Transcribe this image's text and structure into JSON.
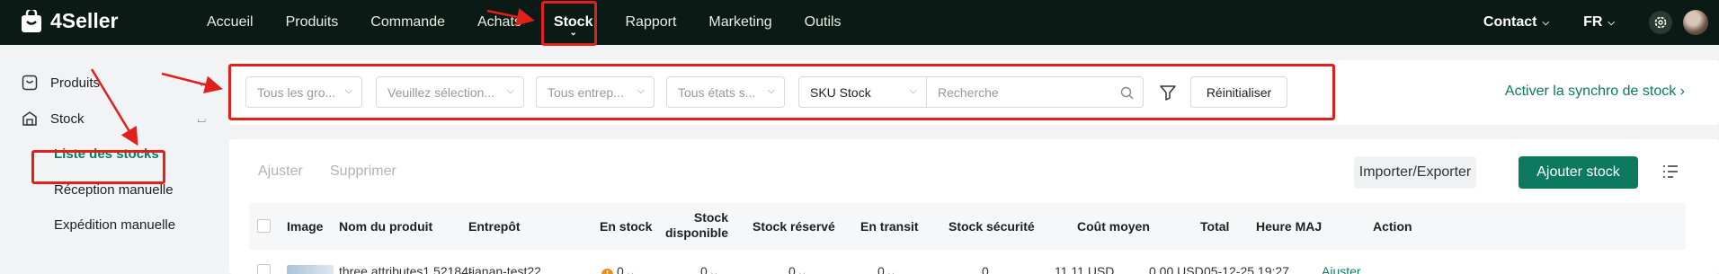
{
  "app": {
    "name": "4Seller"
  },
  "topnav": {
    "items": [
      "Accueil",
      "Produits",
      "Commande",
      "Achats",
      "Stock",
      "Rapport",
      "Marketing",
      "Outils"
    ],
    "active": "Stock"
  },
  "header_right": {
    "contact": "Contact",
    "language": "FR"
  },
  "sidebar": {
    "groups": [
      {
        "label": "Produits",
        "expanded": false
      },
      {
        "label": "Stock",
        "expanded": true
      }
    ],
    "stock_items": [
      "Liste des stocks",
      "Réception manuelle",
      "Expédition manuelle"
    ],
    "active_item": "Liste des stocks"
  },
  "filters": {
    "groups_placeholder": "Tous les gro...",
    "select_placeholder": "Veuillez sélection...",
    "warehouse_placeholder": "Tous entrep...",
    "status_placeholder": "Tous états s...",
    "search_type": "SKU Stock",
    "search_placeholder": "Recherche",
    "reset_label": "Réinitialiser",
    "sync_link": "Activer la synchro de stock"
  },
  "toolbar": {
    "adjust_label": "Ajuster",
    "delete_label": "Supprimer",
    "import_export_label": "Importer/Exporter",
    "add_stock_label": "Ajouter stock"
  },
  "table": {
    "headers": {
      "image": "Image",
      "product_name": "Nom du produit",
      "warehouse": "Entrepôt",
      "in_stock": "En stock",
      "available_line1": "Stock",
      "available_line2": "disponible",
      "reserved": "Stock réservé",
      "in_transit": "En transit",
      "safety": "Stock sécurité",
      "avg_cost": "Coût moyen",
      "total": "Total",
      "updated": "Heure MAJ",
      "action": "Action"
    },
    "rows": [
      {
        "product_name": "three attributes1 52184-",
        "warehouse": "tianan-test22",
        "in_stock": "0",
        "available": "0",
        "reserved": "0",
        "in_transit": "0",
        "safety": "0",
        "avg_cost": "11.11 USD",
        "total": "0.00 USD",
        "updated": "05-12-25 19:27",
        "action": "Ajuster"
      }
    ]
  },
  "colors": {
    "topbar_bg": "#0b1a14",
    "brand_green": "#0d7a5f",
    "annotation_red": "#e0201b",
    "warning_orange": "#f08c1a"
  },
  "icons": [
    "bag-logo-icon",
    "chevron-down-icon",
    "gear-icon",
    "avatar",
    "product-icon",
    "stock-icon",
    "chevron-up-icon",
    "search-icon",
    "filter-icon",
    "list-settings-icon",
    "warning-icon"
  ]
}
